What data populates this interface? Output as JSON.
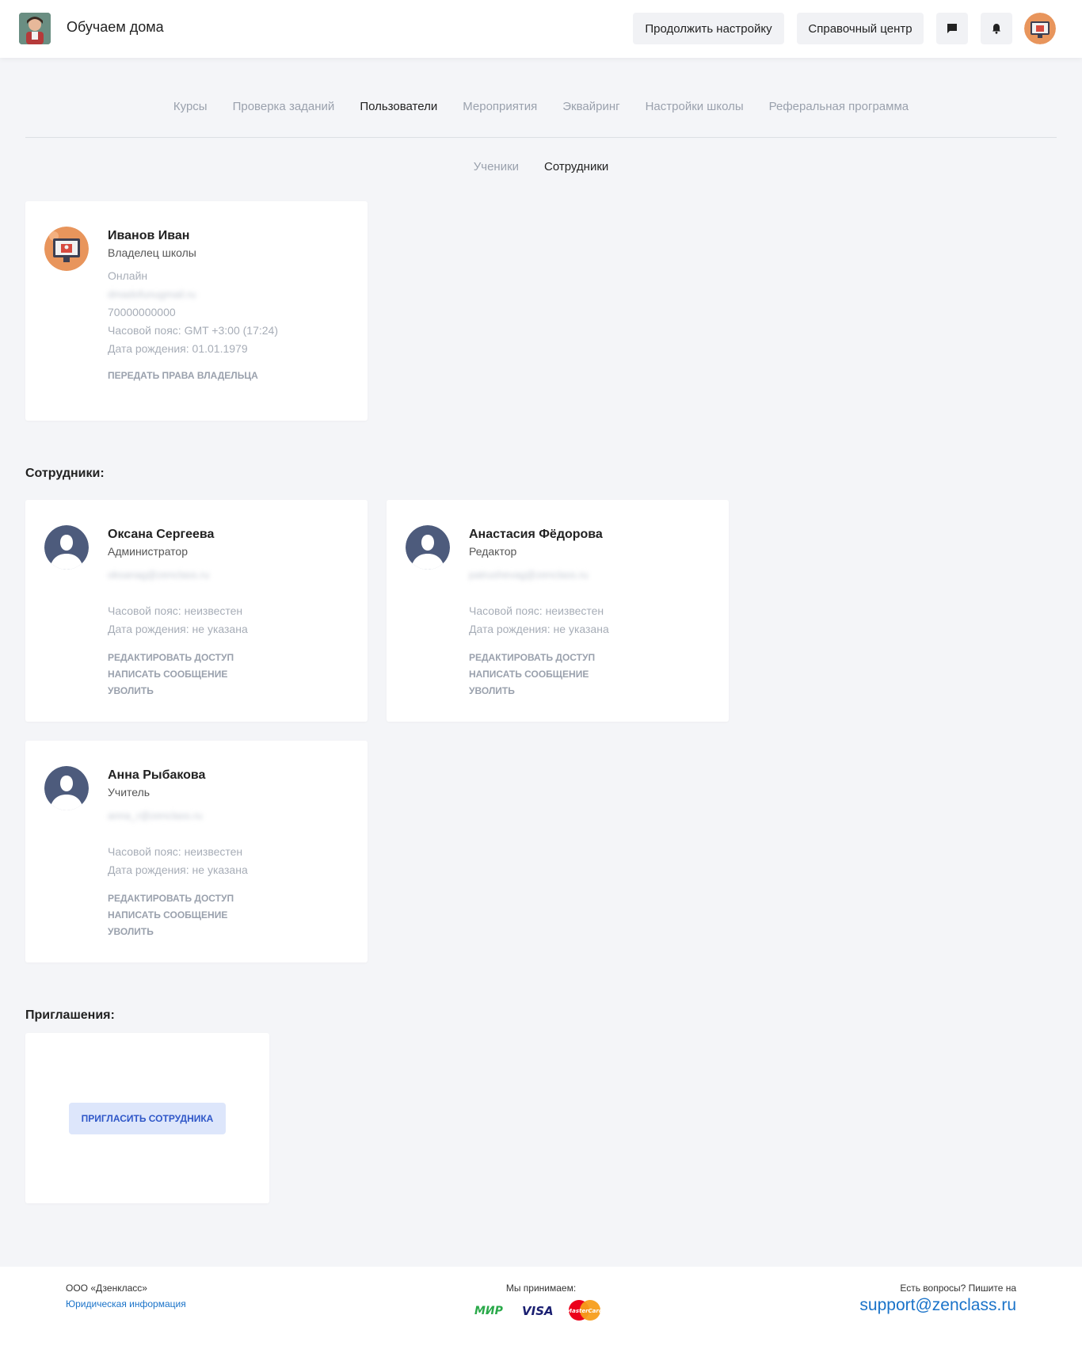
{
  "header": {
    "school_name": "Обучаем дома",
    "continue_setup": "Продолжить настройку",
    "help_center": "Справочный центр"
  },
  "nav": {
    "tabs": [
      "Курсы",
      "Проверка заданий",
      "Пользователи",
      "Мероприятия",
      "Эквайринг",
      "Настройки школы",
      "Реферальная программа"
    ],
    "active": "Пользователи"
  },
  "subnav": {
    "tabs": [
      "Ученики",
      "Сотрудники"
    ],
    "active": "Сотрудники"
  },
  "owner": {
    "name": "Иванов Иван",
    "role": "Владелец школы",
    "status": "Онлайн",
    "email": "dmadofunugmail.ru",
    "phone": "70000000000",
    "timezone": "Часовой пояс: GMT +3:00 (17:24)",
    "birthday": "Дата рождения: 01.01.1979",
    "action": "ПЕРЕДАТЬ ПРАВА ВЛАДЕЛЬЦА"
  },
  "staff_title": "Сотрудники:",
  "staff": [
    {
      "name": "Оксана Сергеева",
      "role": "Администратор",
      "email": "oksanag@zenclass.ru",
      "timezone": "Часовой пояс: неизвестен",
      "birthday": "Дата рождения: не указана",
      "actions": [
        "РЕДАКТИРОВАТЬ ДОСТУП",
        "НАПИСАТЬ СООБЩЕНИЕ",
        "УВОЛИТЬ"
      ]
    },
    {
      "name": "Анастасия Фёдорова",
      "role": "Редактор",
      "email": "patrushevag@zenclass.ru",
      "timezone": "Часовой пояс: неизвестен",
      "birthday": "Дата рождения: не указана",
      "actions": [
        "РЕДАКТИРОВАТЬ ДОСТУП",
        "НАПИСАТЬ СООБЩЕНИЕ",
        "УВОЛИТЬ"
      ]
    },
    {
      "name": "Анна Рыбакова",
      "role": "Учитель",
      "email": "anna_r@zenclass.ru",
      "timezone": "Часовой пояс: неизвестен",
      "birthday": "Дата рождения: не указана",
      "actions": [
        "РЕДАКТИРОВАТЬ ДОСТУП",
        "НАПИСАТЬ СООБЩЕНИЕ",
        "УВОЛИТЬ"
      ]
    }
  ],
  "invites_title": "Приглашения:",
  "invite_button": "ПРИГЛАСИТЬ СОТРУДНИКА",
  "footer": {
    "company": "ООО «Дзенкласс»",
    "legal": "Юридическая информация",
    "accept": "Мы принимаем:",
    "questions": "Есть вопросы? Пишите на",
    "support_email": "support@zenclass.ru",
    "payments": [
      "МИР",
      "VISA",
      "MasterCard"
    ]
  },
  "colors": {
    "accent": "#1a73c9",
    "invite_bg": "#dde6fb",
    "muted": "#9aa1ad"
  }
}
